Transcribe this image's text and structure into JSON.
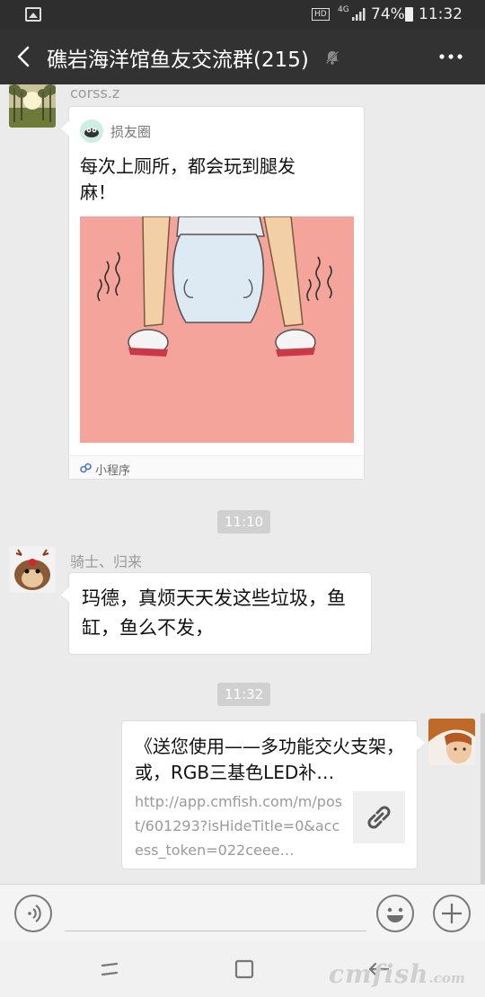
{
  "status_bar": {
    "hd_label": "HD",
    "network": "4G",
    "battery": "74%",
    "time": "11:32"
  },
  "header": {
    "title": "礁岩海洋馆鱼友交流群(215)",
    "icons": {
      "back": "back-arrow-icon",
      "mute": "muted-bell-icon",
      "more": "more-icon"
    }
  },
  "messages": {
    "m1": {
      "sender": "corss.z",
      "app_name": "损友圈",
      "title": "每次上厕所，都会玩到腿发麻！",
      "footer": "小程序"
    },
    "ts1": "11:10",
    "m2": {
      "sender": "骑士、归来",
      "text": "玛德，真烦天天发这些垃圾，鱼缸，鱼么不发，"
    },
    "ts2": "11:32",
    "m3": {
      "title": "《送您使用——多功能交火支架，或，RGB三基色LED补…",
      "url": "http://app.cmfish.com/m/post/601293?isHideTitle=0&access_token=022ceee…"
    }
  },
  "colors": {
    "title_bar": "#323232",
    "status_bar": "#2e2e2e",
    "chat_bg": "#ebebeb",
    "mp_image_bg": "#f5a49b",
    "timestamp_bg": "#d0d0d0"
  },
  "watermark": {
    "main": "cmfish",
    "suffix": ".com"
  }
}
